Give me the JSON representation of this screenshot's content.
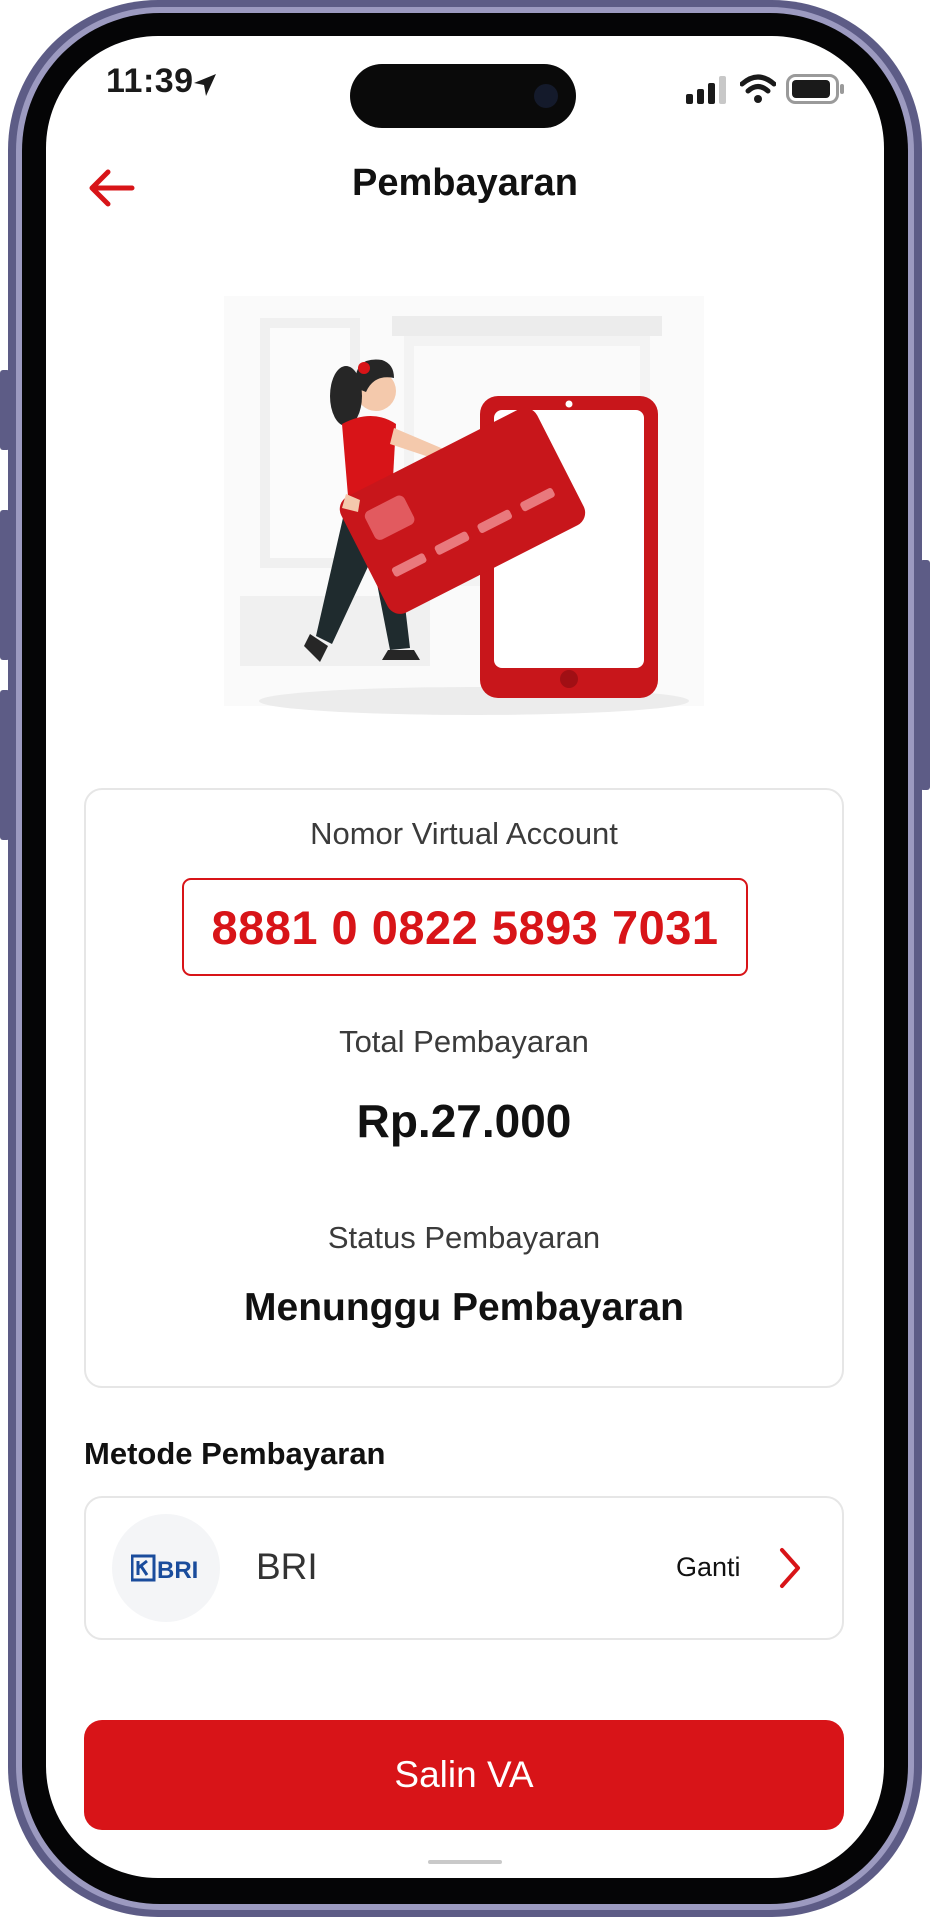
{
  "status_bar": {
    "time": "11:39"
  },
  "header": {
    "title": "Pembayaran"
  },
  "payment_card": {
    "va_label": "Nomor Virtual Account",
    "va_number": "8881 0 0822 5893 7031",
    "total_label": "Total Pembayaran",
    "total_amount": "Rp.27.000",
    "status_label": "Status Pembayaran",
    "status_value": "Menunggu Pembayaran"
  },
  "payment_method": {
    "section_title": "Metode Pembayaran",
    "bank_logo_text": "BRI",
    "bank_name": "BRI",
    "change_label": "Ganti"
  },
  "actions": {
    "copy_va_label": "Salin VA"
  },
  "colors": {
    "accent": "#d81418",
    "frame": "#5d5c86",
    "card_border": "#e6e6e6",
    "bank_logo": "#1a4c9c"
  },
  "icons": {
    "back": "arrow-left-icon",
    "location": "location-arrow-icon",
    "signal": "cellular-signal-icon",
    "wifi": "wifi-icon",
    "battery": "battery-icon",
    "chevron": "chevron-right-icon"
  }
}
